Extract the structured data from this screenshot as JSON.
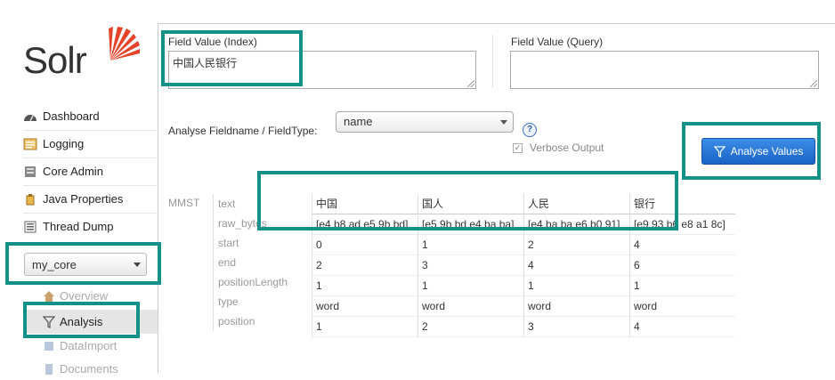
{
  "logo": {
    "text": "Solr"
  },
  "nav": [
    {
      "label": "Dashboard",
      "icon": "dashboard-icon"
    },
    {
      "label": "Logging",
      "icon": "logging-icon"
    },
    {
      "label": "Core Admin",
      "icon": "core-admin-icon"
    },
    {
      "label": "Java Properties",
      "icon": "java-icon"
    },
    {
      "label": "Thread Dump",
      "icon": "thread-icon"
    }
  ],
  "core_selector": {
    "value": "my_core"
  },
  "core_menu": [
    {
      "label": "Overview",
      "state": "faded"
    },
    {
      "label": "Analysis",
      "state": "active"
    },
    {
      "label": "DataImport",
      "state": "faded"
    },
    {
      "label": "Documents",
      "state": "faded"
    }
  ],
  "form": {
    "index_label": "Field Value (Index)",
    "index_value": "中国人民银行",
    "query_label": "Field Value (Query)",
    "query_value": "",
    "fieldtype_label": "Analyse Fieldname / FieldType:",
    "fieldtype_value": "name",
    "help": "?",
    "verbose_label": "Verbose Output",
    "verbose_checked": "✓",
    "analyse_button": "Analyse Values"
  },
  "analysis": {
    "stage": "MMST",
    "row_labels": [
      "text",
      "raw_bytes",
      "start",
      "end",
      "positionLength",
      "type",
      "position"
    ],
    "tokens": [
      {
        "text": "中国",
        "raw_bytes": "[e4 b8 ad e5 9b bd]",
        "start": "0",
        "end": "2",
        "positionLength": "1",
        "type": "word",
        "position": "1"
      },
      {
        "text": "国人",
        "raw_bytes": "[e5 9b bd e4 ba ba]",
        "start": "1",
        "end": "3",
        "positionLength": "1",
        "type": "word",
        "position": "2"
      },
      {
        "text": "人民",
        "raw_bytes": "[e4 ba ba e6 b0 91]",
        "start": "2",
        "end": "4",
        "positionLength": "1",
        "type": "word",
        "position": "3"
      },
      {
        "text": "银行",
        "raw_bytes": "[e9 93 b6 e8 a1 8c]",
        "start": "4",
        "end": "6",
        "positionLength": "1",
        "type": "word",
        "position": "4"
      }
    ]
  },
  "colors": {
    "highlight": "#139088",
    "button": "#1a62c7",
    "sun": "#e5432a"
  }
}
